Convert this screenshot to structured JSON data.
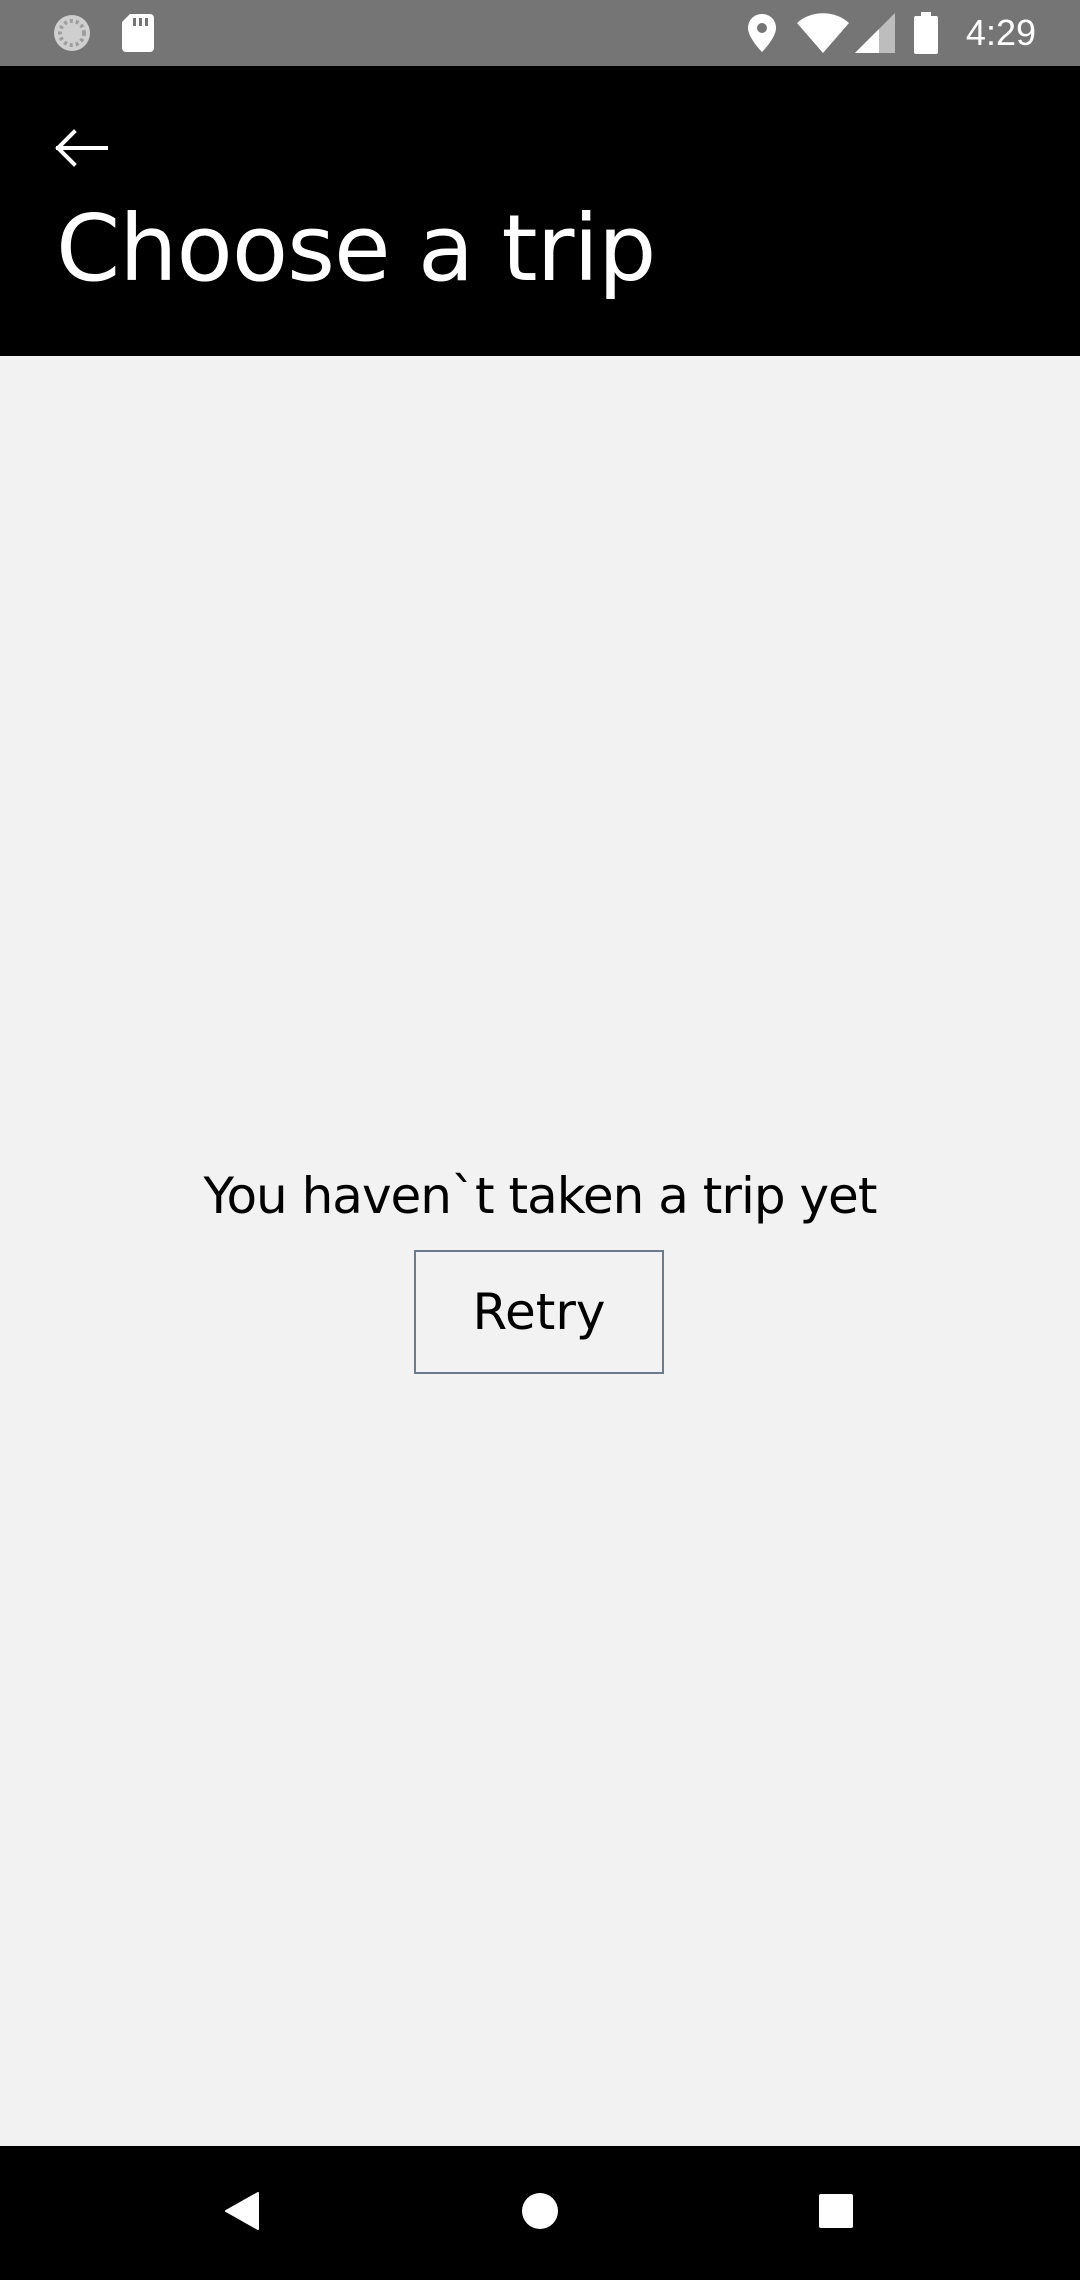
{
  "status_bar": {
    "time": "4:29",
    "icons": [
      "settings-spinner-icon",
      "sd-card-icon",
      "location-icon",
      "wifi-icon",
      "cell-signal-icon",
      "battery-icon"
    ]
  },
  "app_bar": {
    "back_icon": "arrow-left-icon",
    "title": "Choose a trip"
  },
  "main": {
    "empty_message": "You haven`t taken a trip yet",
    "retry_label": "Retry"
  },
  "nav_bar": {
    "buttons": [
      "back",
      "home",
      "recents"
    ]
  },
  "colors": {
    "status_bar": "#757575",
    "app_bar": "#000000",
    "background": "#f2f2f2",
    "button_border": "#6b7b8c"
  }
}
